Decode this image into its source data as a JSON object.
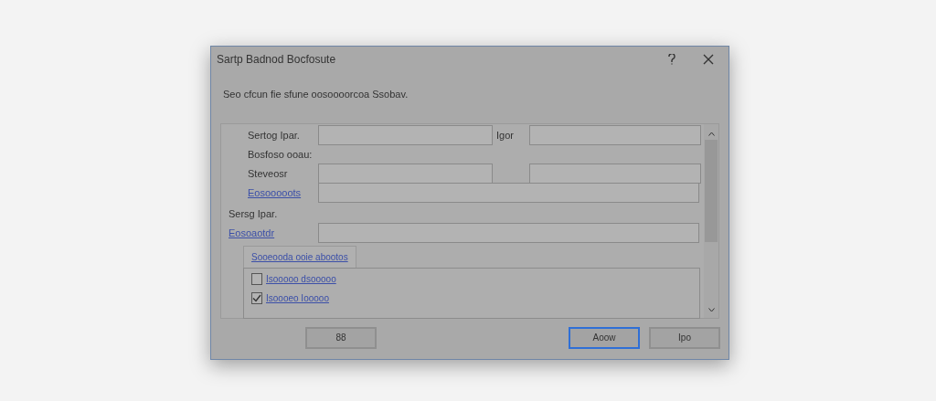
{
  "window": {
    "title": "Sartp Badnod Bocfosute"
  },
  "instruction": "Seo cfcun fie sfune oosoooorcoa Ssobav.",
  "form": {
    "rows": [
      {
        "label": "Sertog Ipar.",
        "kind": "link-less",
        "field_1": "",
        "label_2": "Igor",
        "field_2": ""
      },
      {
        "label": "Bosfoso ooau:"
      },
      {
        "label": "Steveosr",
        "kind": "link-less",
        "field_1": "",
        "field_2": ""
      },
      {
        "label": "Eosooooots",
        "kind": "link"
      },
      {
        "label": "Sersg Ipar.",
        "kind": "heading"
      },
      {
        "label": "Eosoaotdr",
        "kind": "link"
      }
    ]
  },
  "tab": {
    "label": "Sooeooda ooie abootos",
    "selected": true
  },
  "checkboxes": [
    {
      "label": "Isooooo dsooooo",
      "checked": false
    },
    {
      "label": "Isoooeo Iooooo",
      "checked": true
    }
  ],
  "buttons": [
    {
      "label": "88",
      "default": false
    },
    {
      "label": "Aoow",
      "default": true
    },
    {
      "label": "Ipo",
      "default": false
    }
  ]
}
